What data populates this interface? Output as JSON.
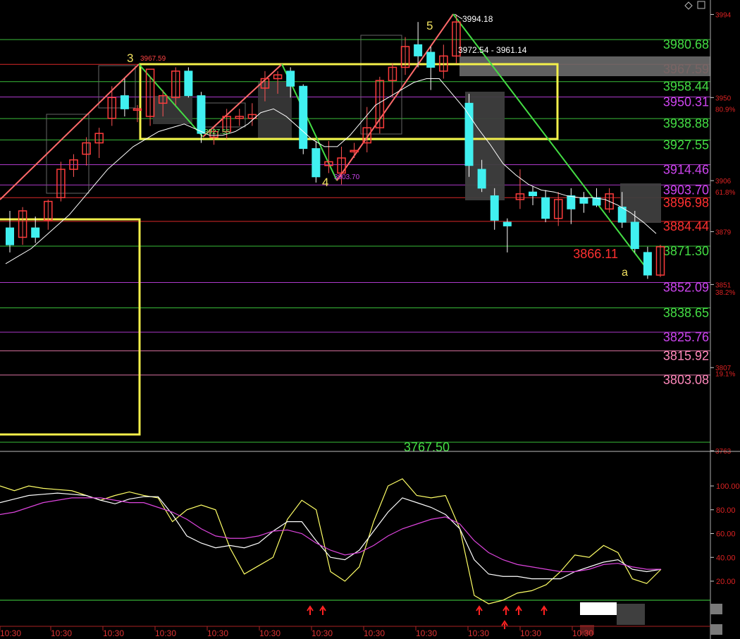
{
  "chart_data": [
    {
      "type": "candlestick",
      "title": "",
      "x_tick_label": "10:30",
      "ylim": [
        3760,
        3998
      ],
      "colors": {
        "up": "#ff3b3b",
        "down": "#40f0f0",
        "ma": "#ffffff",
        "bg": "#000000"
      },
      "candles": [
        [
          3881,
          3890,
          3868,
          3872
        ],
        [
          3876,
          3892,
          3872,
          3890
        ],
        [
          3881,
          3887,
          3873,
          3876
        ],
        [
          3885,
          3896,
          3880,
          3895
        ],
        [
          3897,
          3916,
          3895,
          3912
        ],
        [
          3912,
          3920,
          3908,
          3917
        ],
        [
          3920,
          3929,
          3914,
          3926
        ],
        [
          3926,
          3934,
          3918,
          3931
        ],
        [
          3939,
          3956,
          3935,
          3950
        ],
        [
          3951,
          3960,
          3940,
          3944
        ],
        [
          3944,
          3946,
          3937,
          3944
        ],
        [
          3940,
          3961,
          3935,
          3965
        ],
        [
          3947,
          3954,
          3940,
          3951
        ],
        [
          3950,
          3966,
          3946,
          3964
        ],
        [
          3964,
          3966,
          3950,
          3951
        ],
        [
          3951,
          3953,
          3926,
          3931
        ],
        [
          3929,
          3934,
          3925,
          3932
        ],
        [
          3932,
          3944,
          3928,
          3940
        ],
        [
          3939,
          3944,
          3935,
          3940
        ],
        [
          3939,
          3947,
          3935,
          3941
        ],
        [
          3955,
          3964,
          3948,
          3960
        ],
        [
          3960,
          3964,
          3952,
          3962
        ],
        [
          3964,
          3966,
          3950,
          3956
        ],
        [
          3956,
          3957,
          3920,
          3923
        ],
        [
          3923,
          3927,
          3905,
          3908
        ],
        [
          3914,
          3927,
          3910,
          3916
        ],
        [
          3910,
          3924,
          3904,
          3918
        ],
        [
          3922,
          3926,
          3918,
          3922
        ],
        [
          3926,
          3945,
          3921,
          3934
        ],
        [
          3934,
          3961,
          3931,
          3959
        ],
        [
          3959,
          3968,
          3950,
          3966
        ],
        [
          3966,
          3982,
          3962,
          3977
        ],
        [
          3978,
          3990,
          3966,
          3972
        ],
        [
          3974,
          3977,
          3954,
          3966
        ],
        [
          3964,
          3978,
          3960,
          3972
        ],
        [
          3972,
          3994,
          3968,
          3990
        ],
        [
          3947,
          3952,
          3908,
          3914
        ],
        [
          3912,
          3917,
          3900,
          3902
        ],
        [
          3898,
          3902,
          3880,
          3885
        ],
        [
          3884,
          3886,
          3868,
          3882
        ],
        [
          3896,
          3912,
          3891,
          3899
        ],
        [
          3900,
          3903,
          3893,
          3898
        ],
        [
          3897,
          3901,
          3884,
          3886
        ],
        [
          3886,
          3900,
          3882,
          3896
        ],
        [
          3898,
          3902,
          3883,
          3891
        ],
        [
          3897,
          3900,
          3889,
          3894
        ],
        [
          3897,
          3902,
          3892,
          3893
        ],
        [
          3891,
          3902,
          3889,
          3899
        ],
        [
          3892,
          3900,
          3881,
          3884
        ],
        [
          3884,
          3890,
          3868,
          3870
        ],
        [
          3868,
          3871,
          3854,
          3856
        ],
        [
          3856,
          3872,
          3855,
          3871
        ]
      ],
      "ma_line": [
        3862,
        3866,
        3870,
        3876,
        3882,
        3888,
        3896,
        3904,
        3912,
        3918,
        3924,
        3928,
        3932,
        3934,
        3936,
        3933,
        3930,
        3930,
        3932,
        3936,
        3942,
        3944,
        3940,
        3934,
        3928,
        3924,
        3924,
        3930,
        3938,
        3946,
        3950,
        3954,
        3958,
        3960,
        3960,
        3952,
        3944,
        3934,
        3925,
        3915,
        3909,
        3904,
        3901,
        3900,
        3898,
        3897,
        3897,
        3896,
        3893,
        3889,
        3884,
        3878
      ],
      "price_levels": [
        {
          "value": "3980.68",
          "color": "#44dd44"
        },
        {
          "value": "3967.59",
          "color": "#ff3030"
        },
        {
          "value": "3958.44",
          "color": "#44dd44"
        },
        {
          "value": "3950.31",
          "color": "#cc44ee"
        },
        {
          "value": "3938.88",
          "color": "#44dd44"
        },
        {
          "value": "3927.55",
          "color": "#44dd44"
        },
        {
          "value": "3914.46",
          "color": "#cc44ee"
        },
        {
          "value": "3903.70",
          "color": "#cc44ee"
        },
        {
          "value": "3896.98",
          "color": "#ff3030"
        },
        {
          "value": "3884.44",
          "color": "#ff3030"
        },
        {
          "value": "3871.30",
          "color": "#44dd44"
        },
        {
          "value": "3866.11",
          "color": "#ff3030"
        },
        {
          "value": "3852.09",
          "color": "#cc44ee"
        },
        {
          "value": "3838.65",
          "color": "#44dd44"
        },
        {
          "value": "3825.76",
          "color": "#cc44ee"
        },
        {
          "value": "3815.92",
          "color": "#ff88bb"
        },
        {
          "value": "3803.08",
          "color": "#ff88bb"
        },
        {
          "value": "3767.50",
          "color": "#44dd44"
        }
      ],
      "right_axis_ticks": [
        {
          "label": "3994",
          "value": 3994
        },
        {
          "label": "3950",
          "value": 3950
        },
        {
          "label": "3906",
          "value": 3906
        },
        {
          "label": "3879",
          "value": 3879
        },
        {
          "label": "3851",
          "value": 3851
        },
        {
          "label": "3807",
          "value": 3807
        },
        {
          "label": "3763",
          "value": 3763
        }
      ],
      "fib_ratios": [
        {
          "label": "80.9%",
          "value": 3944
        },
        {
          "label": "61.8%",
          "value": 3900
        },
        {
          "label": "38.2%",
          "value": 3847
        },
        {
          "label": "19.1%",
          "value": 3804
        }
      ],
      "wave_labels": [
        {
          "text": "3",
          "price_text": "3967.59"
        },
        {
          "text": "4",
          "price_text": "3903.70"
        },
        {
          "text": "5",
          "price_text": "3994.18"
        },
        {
          "text": "a",
          "price_text": ""
        }
      ],
      "price_annotations": {
        "low_label": "3927.55",
        "range_label": "3972.54 - 3961.14"
      }
    },
    {
      "type": "line",
      "title": "",
      "ylim": [
        0,
        110
      ],
      "y_ticks": [
        "100.00",
        "80.00",
        "60.00",
        "40.00",
        "20.00"
      ],
      "series": [
        {
          "color": "#ffff66",
          "values": [
            100,
            96,
            100,
            98,
            97,
            96,
            92,
            88,
            92,
            95,
            92,
            90,
            70,
            80,
            84,
            80,
            48,
            26,
            33,
            40,
            72,
            88,
            80,
            28,
            20,
            32,
            70,
            100,
            106,
            92,
            90,
            92,
            64,
            8,
            1,
            4,
            10,
            12,
            17,
            28,
            42,
            40,
            50,
            44,
            22,
            18,
            30
          ]
        },
        {
          "color": "#ffffff",
          "values": [
            86,
            89,
            92,
            93,
            94,
            93,
            92,
            88,
            85,
            89,
            91,
            91,
            76,
            58,
            52,
            48,
            50,
            48,
            52,
            62,
            70,
            70,
            54,
            40,
            38,
            46,
            62,
            78,
            90,
            86,
            82,
            76,
            64,
            38,
            26,
            24,
            24,
            22,
            22,
            22,
            28,
            32,
            36,
            38,
            30,
            28,
            30
          ]
        },
        {
          "color": "#dd44dd",
          "values": [
            76,
            78,
            82,
            86,
            88,
            90,
            90,
            90,
            88,
            86,
            86,
            82,
            78,
            72,
            64,
            58,
            56,
            56,
            58,
            62,
            63,
            60,
            52,
            46,
            42,
            44,
            50,
            58,
            64,
            68,
            72,
            74,
            68,
            54,
            44,
            38,
            34,
            32,
            30,
            28,
            28,
            30,
            34,
            35,
            32,
            30,
            30
          ]
        }
      ],
      "signal_arrows": 7
    }
  ]
}
